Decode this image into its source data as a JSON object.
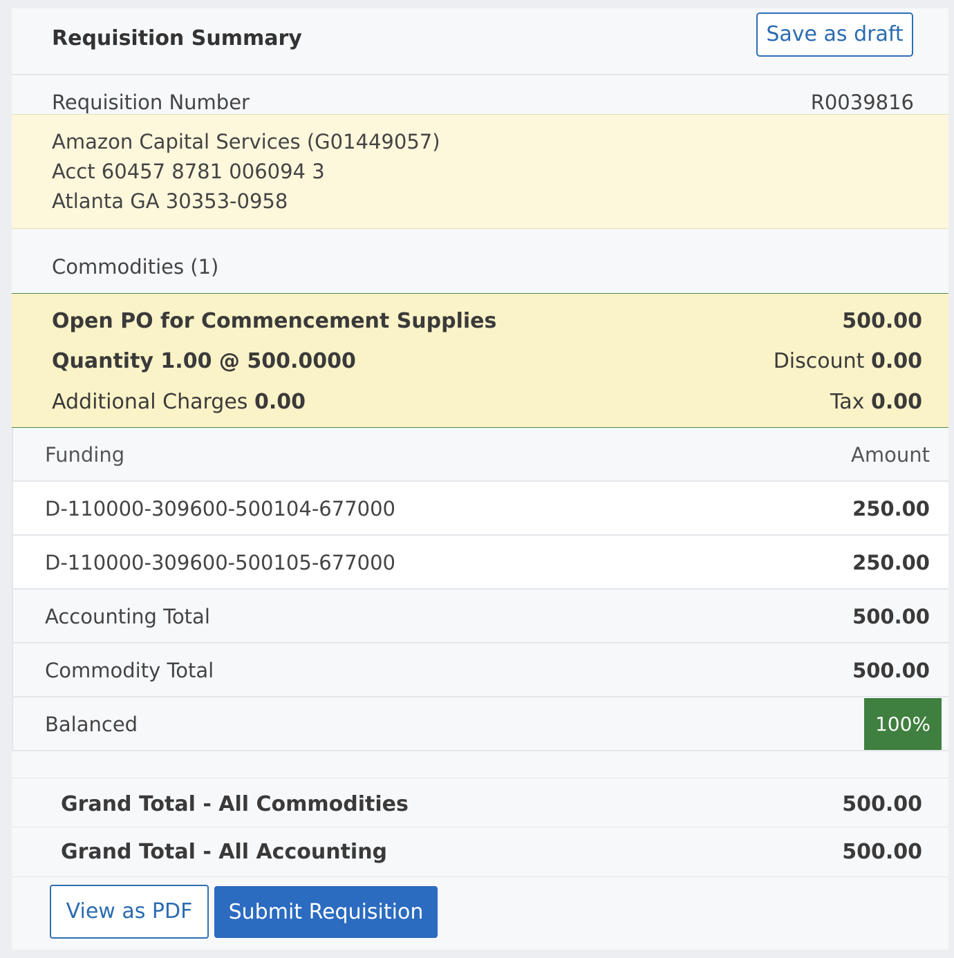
{
  "header": {
    "title": "Requisition Summary",
    "save_draft_label": "Save as draft"
  },
  "requisition": {
    "label": "Requisition Number",
    "value": "R0039816"
  },
  "supplier": {
    "name": "Amazon Capital Services (G01449057)",
    "account": "Acct 60457 8781 006094 3",
    "address": "Atlanta GA 30353-0958"
  },
  "commodities": {
    "heading": "Commodities (1)",
    "item": {
      "description": "Open PO for Commencement Supplies",
      "amount": "500.00",
      "quantity_text": "Quantity 1.00 @ 500.0000",
      "discount_label": "Discount",
      "discount_value": "0.00",
      "additional_label": "Additional Charges",
      "additional_value": "0.00",
      "tax_label": "Tax",
      "tax_value": "0.00"
    }
  },
  "funding": {
    "header_label": "Funding",
    "header_amount": "Amount",
    "rows": [
      {
        "account": "D-110000-309600-500104-677000",
        "amount": "250.00"
      },
      {
        "account": "D-110000-309600-500105-677000",
        "amount": "250.00"
      }
    ],
    "accounting_total_label": "Accounting Total",
    "accounting_total_value": "500.00",
    "commodity_total_label": "Commodity Total",
    "commodity_total_value": "500.00",
    "balanced_label": "Balanced",
    "balanced_value": "100%"
  },
  "grand_totals": {
    "commodities_label": "Grand Total - All Commodities",
    "commodities_value": "500.00",
    "accounting_label": "Grand Total - All Accounting",
    "accounting_value": "500.00"
  },
  "actions": {
    "view_pdf_label": "View as PDF",
    "submit_label": "Submit Requisition"
  },
  "colors": {
    "primary": "#2b6bc0",
    "balanced_badge": "#3f7f3f",
    "supplier_bg": "#fdf7dc",
    "commodity_bg": "#fbf3c8"
  }
}
